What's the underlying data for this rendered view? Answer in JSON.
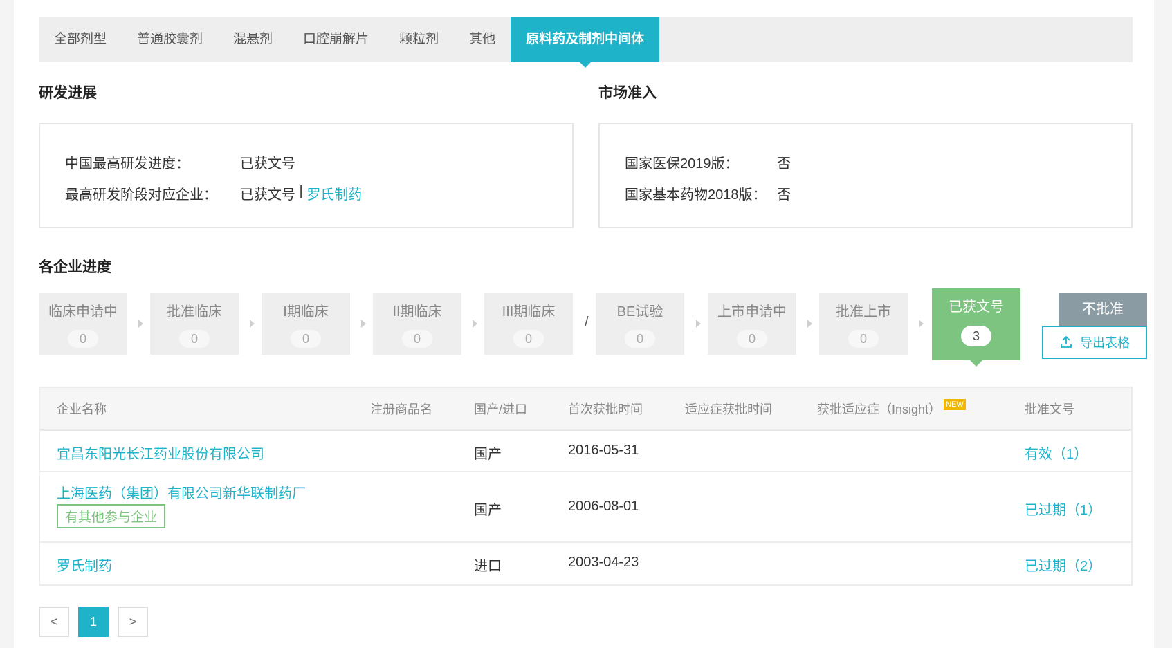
{
  "tabs": [
    {
      "label": "全部剂型",
      "active": false
    },
    {
      "label": "普通胶囊剂",
      "active": false
    },
    {
      "label": "混悬剂",
      "active": false
    },
    {
      "label": "口腔崩解片",
      "active": false
    },
    {
      "label": "颗粒剂",
      "active": false
    },
    {
      "label": "其他",
      "active": false
    },
    {
      "label": "原料药及制剂中间体",
      "active": true
    }
  ],
  "rd": {
    "title": "研发进展",
    "row1_key": "中国最高研发进度：",
    "row1_val": "已获文号",
    "row2_key": "最高研发阶段对应企业：",
    "row2_val": "已获文号",
    "row2_sep": " | ",
    "row2_link": "罗氏制药"
  },
  "market": {
    "title": "市场准入",
    "row1_key": "国家医保2019版：",
    "row1_val": "否",
    "row2_key": "国家基本药物2018版：",
    "row2_val": "否"
  },
  "progress": {
    "title": "各企业进度",
    "steps": [
      {
        "label": "临床申请中",
        "count": "0"
      },
      {
        "label": "批准临床",
        "count": "0"
      },
      {
        "label": "I期临床",
        "count": "0"
      },
      {
        "label": "II期临床",
        "count": "0"
      },
      {
        "label": "III期临床",
        "count": "0"
      },
      {
        "label": "BE试验",
        "count": "0"
      },
      {
        "label": "上市申请中",
        "count": "0"
      },
      {
        "label": "批准上市",
        "count": "0"
      },
      {
        "label": "已获文号",
        "count": "3"
      }
    ],
    "slash": "/",
    "reject_label": "不批准",
    "export_label": "导出表格"
  },
  "table": {
    "headers": {
      "company": "企业名称",
      "brand": "注册商品名",
      "origin": "国产/进口",
      "first_date": "首次获批时间",
      "indication_date": "适应症获批时间",
      "indication": "获批适应症（Insight）",
      "new_badge": "NEW",
      "approval": "批准文号"
    },
    "rows": [
      {
        "company": "宜昌东阳光长江药业股份有限公司",
        "tag": "",
        "origin": "国产",
        "first_date": "2016-05-31",
        "approval": "有效（1）"
      },
      {
        "company": "上海医药（集团）有限公司新华联制药厂",
        "tag": "有其他参与企业",
        "origin": "国产",
        "first_date": "2006-08-01",
        "approval": "已过期（1）"
      },
      {
        "company": "罗氏制药",
        "tag": "",
        "origin": "进口",
        "first_date": "2003-04-23",
        "approval": "已过期（2）"
      }
    ]
  },
  "pagination": {
    "prev": "<",
    "current": "1",
    "next": ">"
  },
  "colors": {
    "accent": "#1eb3c9",
    "success": "#7cc47f",
    "muted": "#8a9ba3",
    "badge": "#f2b705"
  }
}
